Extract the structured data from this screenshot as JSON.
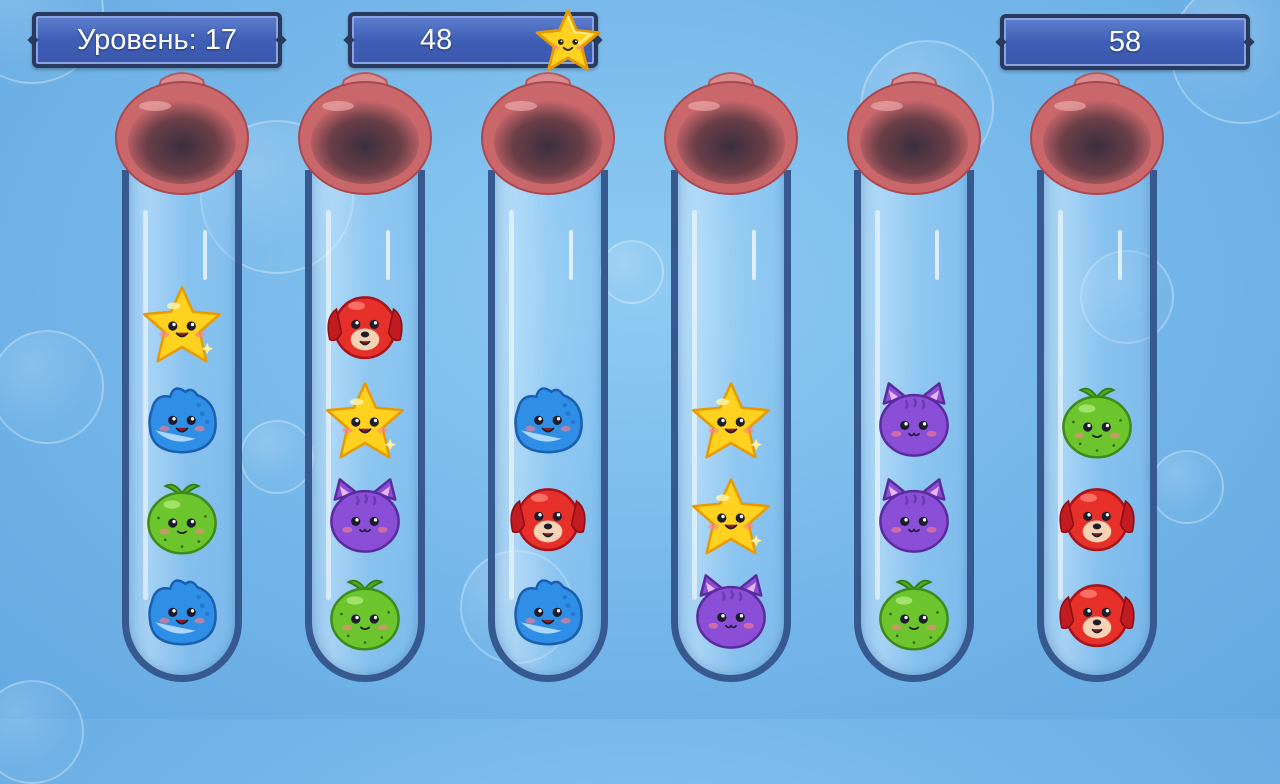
{
  "hud": {
    "level_text": "Уровень: 17",
    "coins": "48",
    "moves": "58"
  },
  "colors": {
    "panel": "#3f5fb6",
    "tube_rim": "#36598f",
    "cap": "#c9676b",
    "yellow": "#ffd21f",
    "blue": "#2f8ee6",
    "green": "#6cc52c",
    "red": "#e8302a",
    "purple": "#8a4fd6"
  },
  "tubes": [
    {
      "name": "tube-1",
      "pieces": [
        "yellow-star",
        "blue-fish",
        "green-cactus",
        "blue-fish"
      ]
    },
    {
      "name": "tube-2",
      "pieces": [
        "red-dog",
        "yellow-star",
        "purple-cat",
        "green-cactus"
      ]
    },
    {
      "name": "tube-3",
      "pieces": [
        "blue-fish",
        "red-dog",
        "blue-fish"
      ]
    },
    {
      "name": "tube-4",
      "pieces": [
        "yellow-star",
        "yellow-star",
        "purple-cat"
      ]
    },
    {
      "name": "tube-5",
      "pieces": [
        "purple-cat",
        "purple-cat",
        "green-cactus"
      ]
    },
    {
      "name": "tube-6",
      "pieces": [
        "green-cactus",
        "red-dog",
        "red-dog"
      ]
    }
  ]
}
